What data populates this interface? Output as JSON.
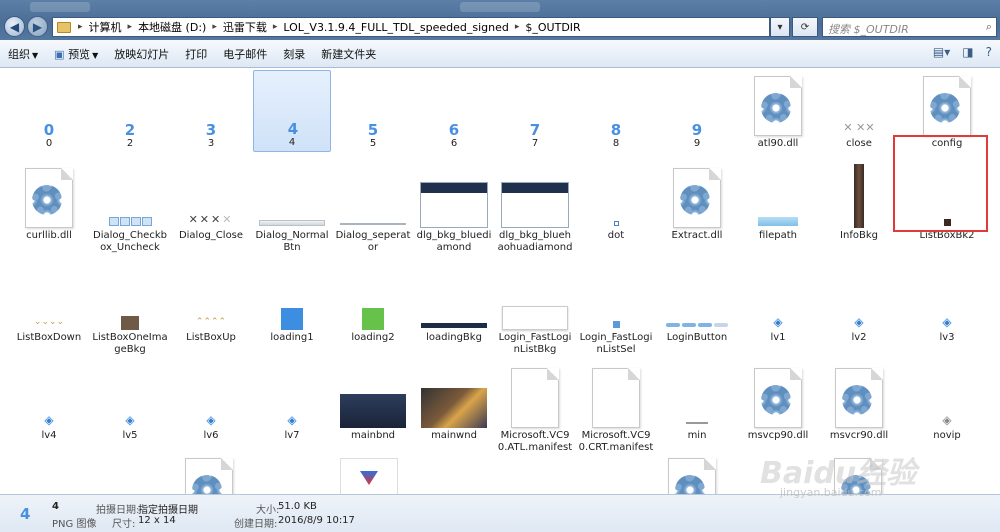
{
  "window": {
    "ghost_tabs": [
      "",
      ""
    ]
  },
  "address": {
    "crumbs": [
      "计算机",
      "本地磁盘 (D:)",
      "迅雷下载",
      "LOL_V3.1.9.4_FULL_TDL_speeded_signed",
      "$_OUTDIR"
    ]
  },
  "search": {
    "placeholder": "搜索 $_OUTDIR"
  },
  "toolbar": {
    "organize": "组织",
    "preview": "预览",
    "slideshow": "放映幻灯片",
    "print": "打印",
    "email": "电子邮件",
    "burn": "刻录",
    "new_folder": "新建文件夹"
  },
  "files": [
    {
      "name": "0",
      "kind": "digit",
      "glyph": "0"
    },
    {
      "name": "2",
      "kind": "digit",
      "glyph": "2"
    },
    {
      "name": "3",
      "kind": "digit",
      "glyph": "3"
    },
    {
      "name": "4",
      "kind": "digit",
      "glyph": "4",
      "selected": true
    },
    {
      "name": "5",
      "kind": "digit",
      "glyph": "5"
    },
    {
      "name": "6",
      "kind": "digit",
      "glyph": "6"
    },
    {
      "name": "7",
      "kind": "digit",
      "glyph": "7"
    },
    {
      "name": "8",
      "kind": "digit",
      "glyph": "8"
    },
    {
      "name": "9",
      "kind": "digit",
      "glyph": "9"
    },
    {
      "name": "atl90.dll",
      "kind": "dll"
    },
    {
      "name": "close",
      "kind": "close"
    },
    {
      "name": "config",
      "kind": "dll",
      "highlighted": true
    },
    {
      "name": "curllib.dll",
      "kind": "dll"
    },
    {
      "name": "Dialog_Checkbox_Uncheck",
      "kind": "checkbox"
    },
    {
      "name": "Dialog_Close",
      "kind": "dlgclose"
    },
    {
      "name": "Dialog_NormalBtn",
      "kind": "normalbtn"
    },
    {
      "name": "Dialog_seperator",
      "kind": "separator"
    },
    {
      "name": "dlg_bkg_bluediamond",
      "kind": "dialog"
    },
    {
      "name": "dlg_bkg_bluehaohuadiamond",
      "kind": "dialog"
    },
    {
      "name": "dot",
      "kind": "dot"
    },
    {
      "name": "Extract.dll",
      "kind": "dll"
    },
    {
      "name": "filepath",
      "kind": "filepath"
    },
    {
      "name": "InfoBkg",
      "kind": "infobkg"
    },
    {
      "name": "ListBoxBk2",
      "kind": "smallsq"
    },
    {
      "name": "ListBoxDown",
      "kind": "chevrons"
    },
    {
      "name": "ListBoxOneImageBkg",
      "kind": "brownsq"
    },
    {
      "name": "ListBoxUp",
      "kind": "chevronsup"
    },
    {
      "name": "loading1",
      "kind": "bluesq"
    },
    {
      "name": "loading2",
      "kind": "greensq"
    },
    {
      "name": "loadingBkg",
      "kind": "darkbar"
    },
    {
      "name": "Login_FastLoginListBkg",
      "kind": "whitebox"
    },
    {
      "name": "Login_FastLoginListSel",
      "kind": "tinyblue"
    },
    {
      "name": "LoginButton",
      "kind": "pills"
    },
    {
      "name": "lv1",
      "kind": "diamond"
    },
    {
      "name": "lv2",
      "kind": "diamond"
    },
    {
      "name": "lv3",
      "kind": "diamond"
    },
    {
      "name": "lv4",
      "kind": "diamond"
    },
    {
      "name": "lv5",
      "kind": "diamond"
    },
    {
      "name": "lv6",
      "kind": "diamond"
    },
    {
      "name": "lv7",
      "kind": "diamond"
    },
    {
      "name": "mainbnd",
      "kind": "navyrect"
    },
    {
      "name": "mainwnd",
      "kind": "hero"
    },
    {
      "name": "Microsoft.VC90.ATL.manifest",
      "kind": "blankdoc"
    },
    {
      "name": "Microsoft.VC90.CRT.manifest",
      "kind": "blankdoc"
    },
    {
      "name": "min",
      "kind": "minbar"
    },
    {
      "name": "msvcp90.dll",
      "kind": "dll"
    },
    {
      "name": "msvcr90.dll",
      "kind": "dll"
    },
    {
      "name": "novip",
      "kind": "novip"
    }
  ],
  "status": {
    "icon_glyph": "4",
    "name": "4",
    "type": "PNG 图像",
    "date_taken_label": "拍摄日期:",
    "date_taken_value": "指定拍摄日期",
    "dims_label": "尺寸:",
    "dims_value": "12 x 14",
    "size_label": "大小:",
    "size_value": "51.0 KB",
    "created_label": "创建日期:",
    "created_value": "2016/8/9 10:17"
  },
  "watermark": {
    "text": "Baidu经验",
    "url": "jingyan.baidu.com"
  },
  "colors": {
    "accent": "#4a90e2",
    "highlight_border": "#e03a3a",
    "titlebar": "#4a6d96"
  }
}
